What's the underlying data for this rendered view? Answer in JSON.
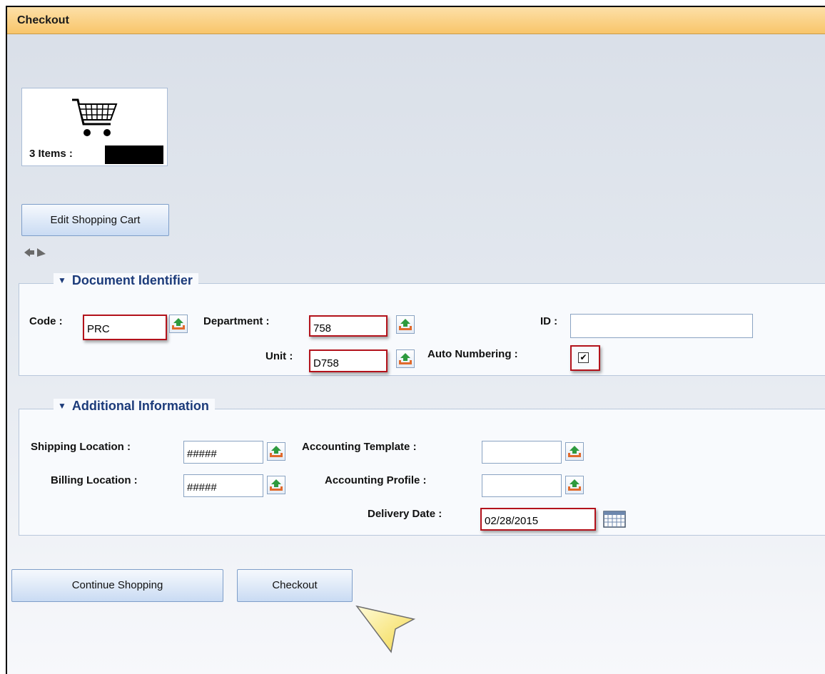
{
  "window": {
    "title": "Checkout"
  },
  "cart": {
    "items_label": "3 Items :"
  },
  "buttons": {
    "edit_cart": "Edit Shopping Cart",
    "continue_shopping": "Continue Shopping",
    "checkout": "Checkout"
  },
  "document_identifier": {
    "legend": "Document Identifier",
    "code_label": "Code :",
    "code_value": "PRC",
    "department_label": "Department :",
    "department_value": "758",
    "id_label": "ID :",
    "id_value": "",
    "unit_label": "Unit :",
    "unit_value": "D758",
    "auto_numbering_label": "Auto Numbering :",
    "auto_numbering_checked": true,
    "checkmark": "✔"
  },
  "additional_information": {
    "legend": "Additional Information",
    "shipping_location_label": "Shipping Location :",
    "shipping_location_value": "#####",
    "billing_location_label": "Billing Location :",
    "billing_location_value": "#####",
    "accounting_template_label": "Accounting Template :",
    "accounting_template_value": "",
    "accounting_profile_label": "Accounting Profile :",
    "accounting_profile_value": "",
    "delivery_date_label": "Delivery Date :",
    "delivery_date_value": "02/28/2015"
  },
  "icons": {
    "cart": "shopping-cart-icon",
    "lookup": "lookup-icon",
    "calendar": "calendar-icon",
    "collapse": "triangle-down-icon",
    "pointer": "callout-pointer-icon"
  },
  "colors": {
    "title_bar": "#f8c56a",
    "highlight_border": "#b3121b",
    "legend_text": "#1c3b7a"
  }
}
